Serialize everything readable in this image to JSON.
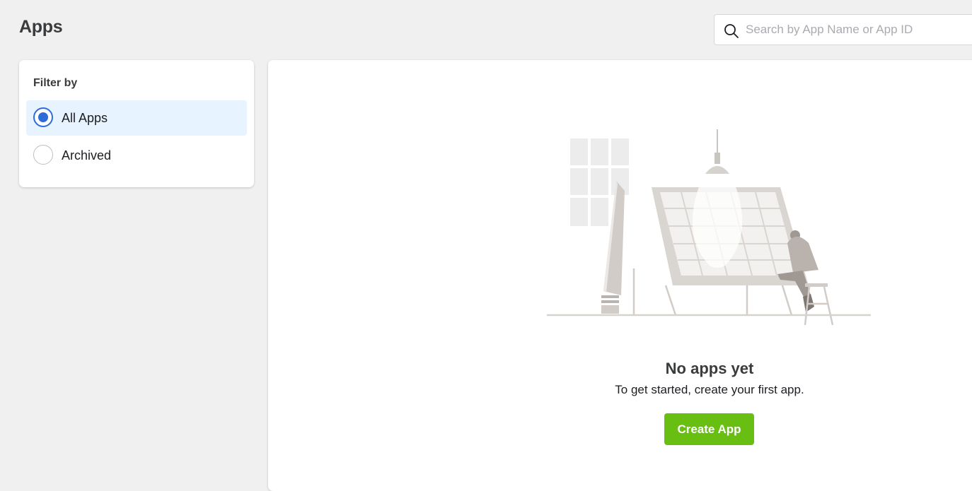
{
  "header": {
    "title": "Apps"
  },
  "search": {
    "placeholder": "Search by App Name or App ID",
    "value": "",
    "icon": "search-icon"
  },
  "filter": {
    "title": "Filter by",
    "options": [
      {
        "label": "All Apps",
        "selected": true
      },
      {
        "label": "Archived",
        "selected": false
      }
    ]
  },
  "empty_state": {
    "title": "No apps yet",
    "subtitle": "To get started, create your first app.",
    "illustration": "person-at-drafting-table-illustration"
  },
  "actions": {
    "create_label": "Create App"
  },
  "colors": {
    "accent": "#2e6dd8",
    "selected_bg": "#e7f3ff",
    "primary_button": "#69bf11",
    "page_bg": "#f0f0f0"
  }
}
